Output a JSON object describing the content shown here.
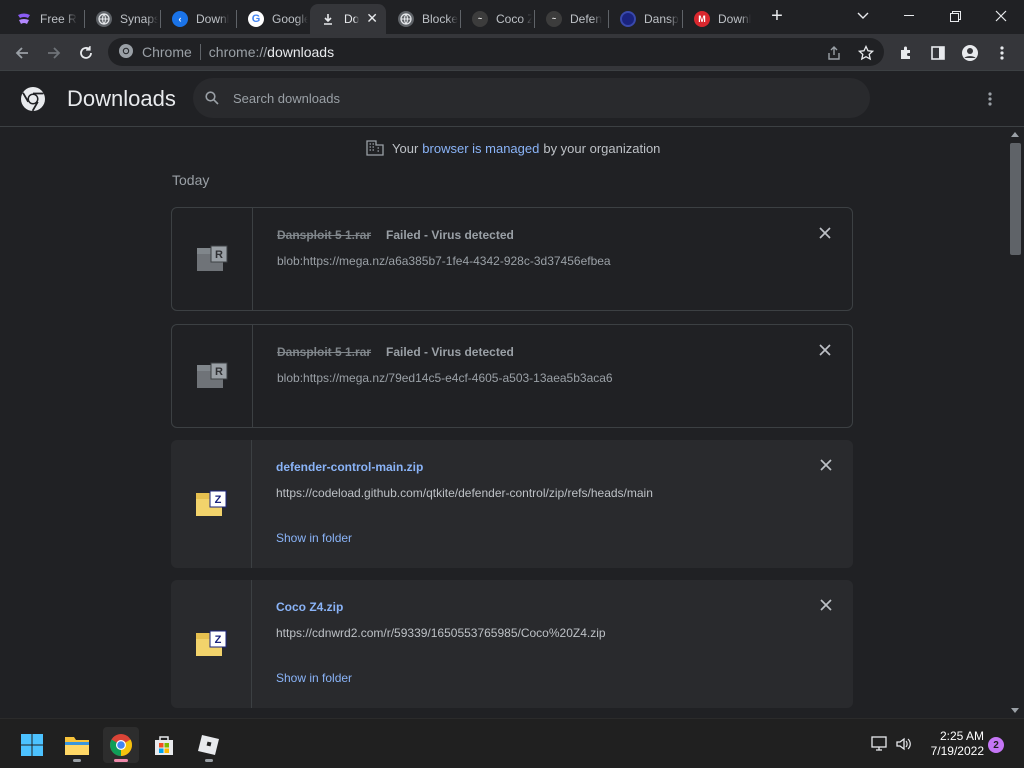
{
  "browser": {
    "tabs": [
      {
        "title": "Free R",
        "favicon": "synapse-icon",
        "color": "#8a5cf6"
      },
      {
        "title": "Synapse",
        "favicon": "globe-icon",
        "color": "#9aa0a6"
      },
      {
        "title": "Downl",
        "favicon": "blue-icon",
        "color": "#1a73e8"
      },
      {
        "title": "Google",
        "favicon": "google-icon",
        "color": "#ffffff"
      },
      {
        "title": "Do",
        "favicon": "download-icon",
        "color": "#e8eaed",
        "active": true
      },
      {
        "title": "Blocke",
        "favicon": "globe-icon",
        "color": "#9aa0a6"
      },
      {
        "title": "Coco Z",
        "favicon": "coco-icon",
        "color": "#666666"
      },
      {
        "title": "Defen",
        "favicon": "coco-icon",
        "color": "#666666"
      },
      {
        "title": "Dansp",
        "favicon": "dansploit-icon",
        "color": "#3949ab"
      },
      {
        "title": "Downl",
        "favicon": "mega-icon",
        "color": "#d9272e"
      }
    ],
    "omnibox": {
      "site_label": "Chrome",
      "url_scheme": "chrome://",
      "url_host": "downloads"
    }
  },
  "downloads": {
    "title": "Downloads",
    "search_placeholder": "Search downloads",
    "managed": {
      "prefix": "Your",
      "link": "browser is managed",
      "suffix": "by your organization"
    },
    "section_label": "Today",
    "show_in_folder": "Show in folder",
    "items": [
      {
        "name": "Dansploit 5 1.rar",
        "status": "Failed - Virus detected",
        "url": "blob:https://mega.nz/a6a385b7-1fe4-4342-928c-3d37456efbea",
        "failed": true,
        "icon": "rar-file-icon"
      },
      {
        "name": "Dansploit 5 1.rar",
        "status": "Failed - Virus detected",
        "url": "blob:https://mega.nz/79ed14c5-e4cf-4605-a503-13aea5b3aca6",
        "failed": true,
        "icon": "rar-file-icon"
      },
      {
        "name": "defender-control-main.zip",
        "status": "",
        "url": "https://codeload.github.com/qtkite/defender-control/zip/refs/heads/main",
        "failed": false,
        "icon": "zip-file-icon"
      },
      {
        "name": "Coco Z4.zip",
        "status": "",
        "url": "https://cdnwrd2.com/r/59339/1650553765985/Coco%20Z4.zip",
        "failed": false,
        "icon": "zip-file-icon"
      }
    ]
  },
  "taskbar": {
    "apps": [
      "windows-start-icon",
      "file-explorer-icon",
      "chrome-icon",
      "microsoft-store-icon",
      "roblox-icon"
    ],
    "clock_time": "2:25 AM",
    "clock_date": "7/19/2022",
    "notification_count": "2"
  },
  "colors": {
    "accent_link": "#8ab4f8",
    "background": "#202124",
    "card": "#292a2d"
  }
}
